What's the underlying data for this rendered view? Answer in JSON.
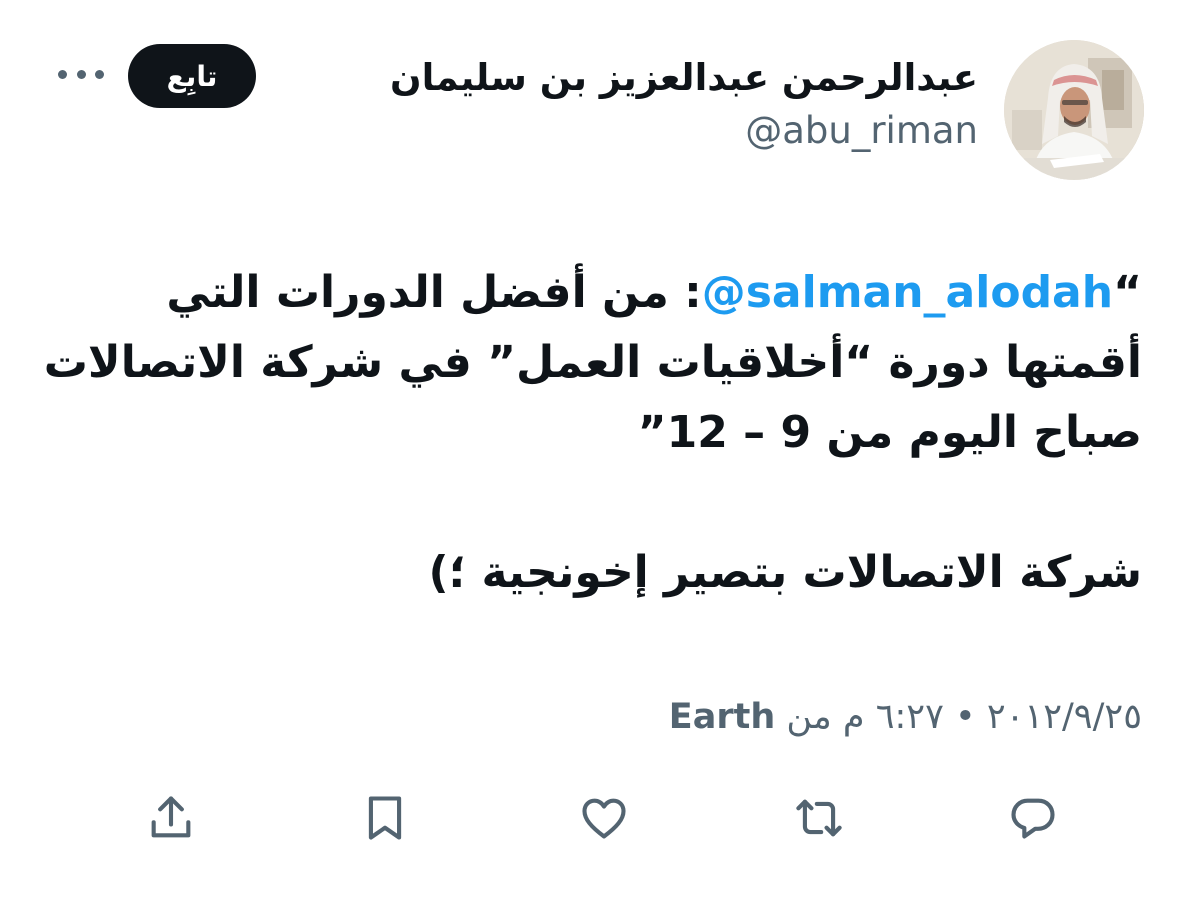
{
  "header": {
    "display_name": "عبدالرحمن عبدالعزيز بن سليمان",
    "handle": "@abu_riman",
    "follow_label": "تابِع"
  },
  "tweet": {
    "open_quote": "“",
    "mention": "@salman_alodah",
    "line1_text": ": من أفضل الدورات التي",
    "line2": "أقمتها دورة “أخلاقيات العمل” في شركة الاتصالات",
    "line3": "صباح اليوم من 9 – 12”",
    "line4": "شركة الاتصالات بتصير إخونجية ؛)"
  },
  "meta": {
    "date_time": "٢٠١٢/٩/٢٥ • ٦:٢٧ م",
    "from_label": "من",
    "source": "Earth"
  },
  "colors": {
    "text": "#0f1419",
    "secondary": "#536471",
    "link": "#1d9bf0",
    "follow_bg": "#0f1419"
  },
  "icons": {
    "avatar": "avatar",
    "more": "more-icon",
    "reply": "reply-icon",
    "retweet": "retweet-icon",
    "like": "heart-icon",
    "bookmark": "bookmark-icon",
    "share": "share-icon"
  }
}
